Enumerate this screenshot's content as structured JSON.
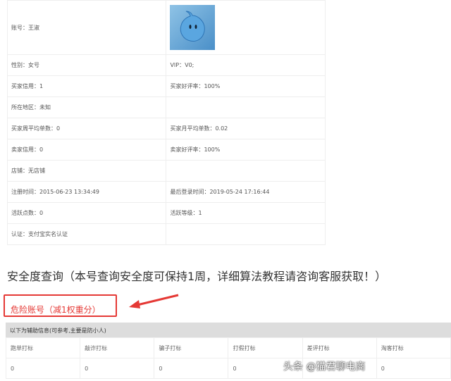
{
  "account": {
    "rows": [
      [
        "账号：王淑",
        ""
      ],
      [
        "性别：女号",
        "VIP：V0;"
      ],
      [
        "买家信用：1",
        "买家好评率：100%"
      ],
      [
        "所在地区：未知",
        ""
      ],
      [
        "买家周平均单数：0",
        "买家月平均单数：0.02"
      ],
      [
        "卖家信用：0",
        "卖家好评率：100%"
      ],
      [
        "店铺：无店铺",
        ""
      ],
      [
        "注册时间：2015-06-23 13:34:49",
        "最后登录时间：2019-05-24 17:16:44"
      ],
      [
        "活跃点数：0",
        "活跃等级：1"
      ],
      [
        "认证：支付宝实名认证",
        ""
      ]
    ]
  },
  "safety": {
    "title": "安全度查询（本号查询安全度可保持1周，详细算法教程请咨询客服获取！）",
    "status": "危险账号（减1权重分）",
    "status_color": "#e53935",
    "sub_header": "以下为辅助信息(可参考,主要是防小人)",
    "columns": [
      "跑单打标",
      "敲诈打标",
      "骗子打标",
      "打假打标",
      "差评打标",
      "淘客打标"
    ],
    "values": [
      "0",
      "0",
      "0",
      "0",
      "0",
      "0"
    ]
  },
  "watermark": "头条 @猫君聊电商"
}
